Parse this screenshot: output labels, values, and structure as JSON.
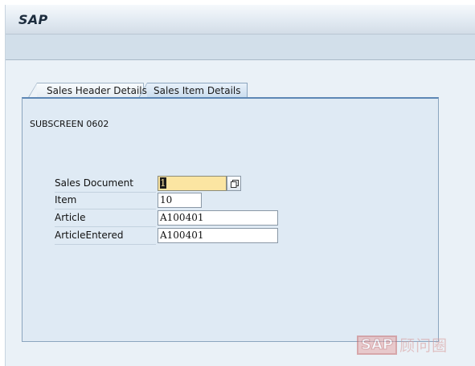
{
  "app": {
    "title": "SAP"
  },
  "tabs": [
    {
      "label": "Sales Header Details",
      "active": false
    },
    {
      "label": "Sales Item Details",
      "active": true
    }
  ],
  "subscreen": {
    "title": "SUBSCREEN 0602"
  },
  "form": {
    "sales_document": {
      "label": "Sales Document",
      "value": "1"
    },
    "item": {
      "label": "Item",
      "value": "10"
    },
    "article": {
      "label": "Article",
      "value": "A100401"
    },
    "article_entered": {
      "label": "ArticleEntered",
      "value": "A100401"
    }
  },
  "icons": {
    "value_help": "value-help-icon"
  },
  "watermark": {
    "logo": "SAP",
    "text": "顾问圈"
  },
  "colors": {
    "required_field": "#fbe5a2",
    "active_tab_border": "#5d87b5",
    "panel_background": "#dfeaf4"
  }
}
